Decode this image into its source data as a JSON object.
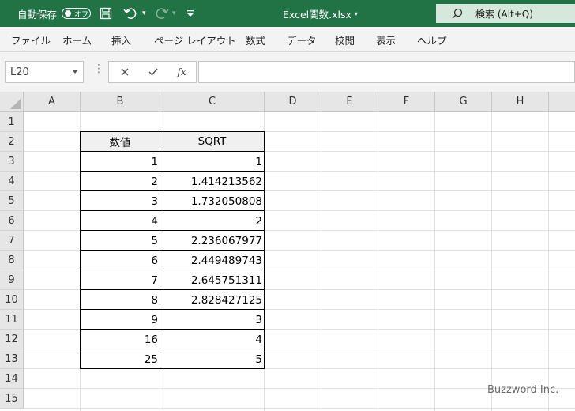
{
  "titlebar": {
    "autosave_label": "自動保存",
    "autosave_state": "オフ",
    "file_name": "Excel関数.xlsx",
    "search_label": "検索 (Alt+Q)",
    "accent": "#217346"
  },
  "ribbon": {
    "tabs": [
      "ファイル",
      "ホーム",
      "挿入",
      "ページ レイアウト",
      "数式",
      "データ",
      "校閲",
      "表示",
      "ヘルプ"
    ]
  },
  "formula_bar": {
    "name_box": "L20",
    "fx_label": "fx",
    "formula": ""
  },
  "sheet": {
    "columns": [
      "A",
      "B",
      "C",
      "D",
      "E",
      "F",
      "G",
      "H"
    ],
    "rows": [
      "1",
      "2",
      "3",
      "4",
      "5",
      "6",
      "7",
      "8",
      "9",
      "10",
      "11",
      "12",
      "13",
      "14",
      "15"
    ],
    "table": {
      "headers": [
        "数値",
        "SQRT"
      ],
      "rows": [
        [
          "1",
          "1"
        ],
        [
          "2",
          "1.414213562"
        ],
        [
          "3",
          "1.732050808"
        ],
        [
          "4",
          "2"
        ],
        [
          "5",
          "2.236067977"
        ],
        [
          "6",
          "2.449489743"
        ],
        [
          "7",
          "2.645751311"
        ],
        [
          "8",
          "2.828427125"
        ],
        [
          "9",
          "3"
        ],
        [
          "16",
          "4"
        ],
        [
          "25",
          "5"
        ]
      ]
    }
  },
  "watermark": "Buzzword Inc.",
  "icons": [
    "save-icon",
    "undo-icon",
    "redo-icon",
    "customize-qat-icon",
    "search-icon",
    "cancel-icon",
    "enter-icon",
    "insert-function-icon",
    "select-all-icon"
  ]
}
